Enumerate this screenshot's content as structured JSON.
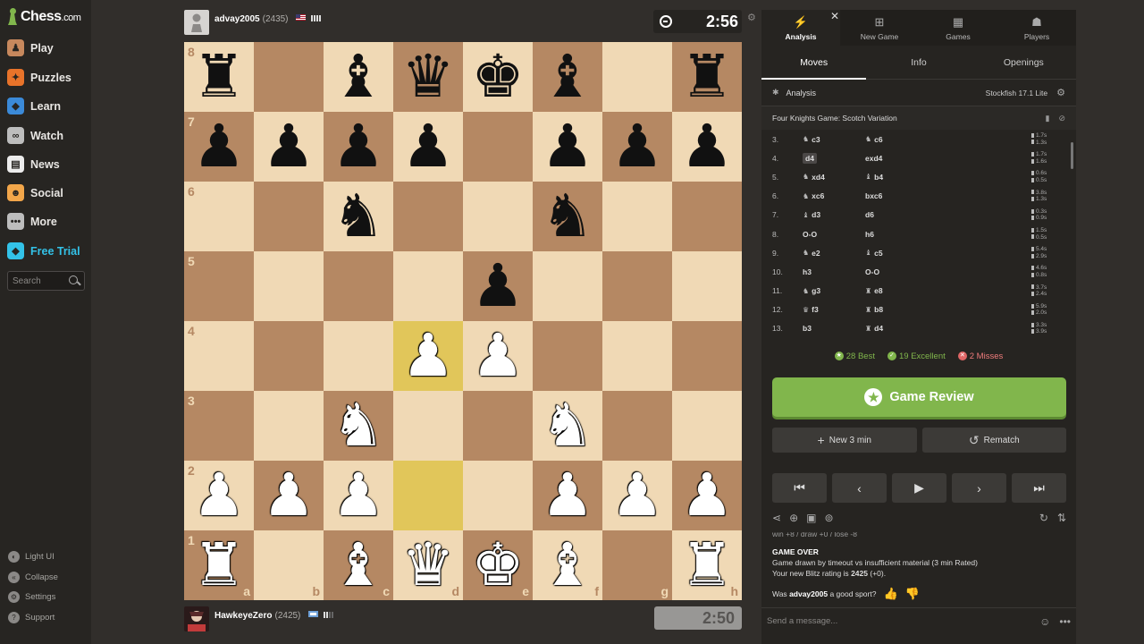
{
  "sidebar": {
    "logo": {
      "main": "Chess",
      "suffix": ".com"
    },
    "nav": [
      {
        "label": "Play",
        "icon": "play-icon",
        "color": "#c7885d",
        "glyph": "♟"
      },
      {
        "label": "Puzzles",
        "icon": "puzzles-icon",
        "color": "#e8732a",
        "glyph": "✦"
      },
      {
        "label": "Learn",
        "icon": "learn-icon",
        "color": "#3b8ad8",
        "glyph": "◆"
      },
      {
        "label": "Watch",
        "icon": "watch-icon",
        "color": "#bdbdbd",
        "glyph": "∞"
      },
      {
        "label": "News",
        "icon": "news-icon",
        "color": "#ececec",
        "glyph": "▤"
      },
      {
        "label": "Social",
        "icon": "social-icon",
        "color": "#f2a64a",
        "glyph": "☻"
      },
      {
        "label": "More",
        "icon": "more-icon",
        "color": "#bdbdbd",
        "glyph": "•••"
      },
      {
        "label": "Free Trial",
        "icon": "diamond-icon",
        "color": "#33c2e8",
        "glyph": "◆"
      }
    ],
    "search_placeholder": "Search",
    "bottom": [
      {
        "label": "Light UI",
        "icon": "light-ui-icon"
      },
      {
        "label": "Collapse",
        "icon": "collapse-icon"
      },
      {
        "label": "Settings",
        "icon": "settings-icon"
      },
      {
        "label": "Support",
        "icon": "support-icon"
      }
    ]
  },
  "top_player": {
    "name": "advay2005",
    "rating": "(2435)",
    "clock": "2:56"
  },
  "bottom_player": {
    "name": "HawkeyeZero",
    "rating": "(2425)",
    "clock": "2:50"
  },
  "board": {
    "rows": [
      [
        "r",
        "",
        "b",
        "q",
        "k",
        "b",
        "",
        "r"
      ],
      [
        "p",
        "p",
        "p",
        "p",
        "",
        "p",
        "p",
        "p"
      ],
      [
        "",
        "",
        "n",
        "",
        "",
        "n",
        "",
        ""
      ],
      [
        "",
        "",
        "",
        "",
        "p",
        "",
        "",
        ""
      ],
      [
        "",
        "",
        "",
        "P",
        "P",
        "",
        "",
        ""
      ],
      [
        "",
        "",
        "N",
        "",
        "",
        "N",
        "",
        ""
      ],
      [
        "P",
        "P",
        "P",
        "",
        "",
        "P",
        "P",
        "P"
      ],
      [
        "R",
        "",
        "B",
        "Q",
        "K",
        "B",
        "",
        "R"
      ]
    ],
    "highlighted": [
      "d4",
      "d2"
    ],
    "ranks": [
      "8",
      "7",
      "6",
      "5",
      "4",
      "3",
      "2",
      "1"
    ],
    "files": [
      "a",
      "b",
      "c",
      "d",
      "e",
      "f",
      "g",
      "h"
    ]
  },
  "panel": {
    "top_tabs": [
      {
        "label": "Analysis",
        "glyph": "⚡",
        "icon": "analysis-icon"
      },
      {
        "label": "New Game",
        "glyph": "⊞",
        "icon": "new-game-icon"
      },
      {
        "label": "Games",
        "glyph": "▦",
        "icon": "games-icon"
      },
      {
        "label": "Players",
        "glyph": "☗",
        "icon": "players-icon"
      }
    ],
    "sub_tabs": [
      "Moves",
      "Info",
      "Openings"
    ],
    "analysis_label": "Analysis",
    "engine": "Stockfish 17.1 Lite",
    "opening": "Four Knights Game: Scotch Variation",
    "moves": [
      {
        "n": "3.",
        "w": "c3",
        "wp": "♞",
        "b": "c6",
        "bp": "♞",
        "wt": "1.7s",
        "bt": "1.3s"
      },
      {
        "n": "4.",
        "w": "d4",
        "wp": "",
        "b": "exd4",
        "bp": "",
        "wt": "1.7s",
        "bt": "1.6s",
        "cur": true
      },
      {
        "n": "5.",
        "w": "xd4",
        "wp": "♞",
        "b": "b4",
        "bp": "♝",
        "wt": "0.6s",
        "bt": "0.5s"
      },
      {
        "n": "6.",
        "w": "xc6",
        "wp": "♞",
        "b": "bxc6",
        "bp": "",
        "wt": "3.8s",
        "bt": "1.3s"
      },
      {
        "n": "7.",
        "w": "d3",
        "wp": "♝",
        "b": "d6",
        "bp": "",
        "wt": "0.3s",
        "bt": "0.9s"
      },
      {
        "n": "8.",
        "w": "O-O",
        "wp": "",
        "b": "h6",
        "bp": "",
        "wt": "1.5s",
        "bt": "0.5s"
      },
      {
        "n": "9.",
        "w": "e2",
        "wp": "♞",
        "b": "c5",
        "bp": "♝",
        "wt": "5.4s",
        "bt": "2.9s"
      },
      {
        "n": "10.",
        "w": "h3",
        "wp": "",
        "b": "O-O",
        "bp": "",
        "wt": "4.6s",
        "bt": "0.8s"
      },
      {
        "n": "11.",
        "w": "g3",
        "wp": "♞",
        "b": "e8",
        "bp": "♜",
        "wt": "3.7s",
        "bt": "2.4s"
      },
      {
        "n": "12.",
        "w": "f3",
        "wp": "♛",
        "b": "b8",
        "bp": "♜",
        "wt": "5.9s",
        "bt": "2.0s"
      },
      {
        "n": "13.",
        "w": "b3",
        "wp": "",
        "b": "d4",
        "bp": "♜",
        "wt": "3.3s",
        "bt": "3.9s"
      }
    ],
    "summary": {
      "best": "28 Best",
      "excellent": "19 Excellent",
      "misses": "2 Misses"
    },
    "review_label": "Game Review",
    "new_game_label": "New 3 min",
    "rematch_label": "Rematch",
    "chat": {
      "cut_line": "win +8 / draw +0 / lose -8",
      "title": "GAME OVER",
      "line1": "Game drawn by timeout vs insufficient material (3 min Rated)",
      "line2_prefix": "Your new Blitz rating is",
      "line2_rating": "2425",
      "line2_suffix": "(+0).",
      "ask_prefix": "Was",
      "ask_name": "advay2005",
      "ask_suffix": "a good sport?"
    },
    "message_placeholder": "Send a message..."
  },
  "colors": {
    "light_square": "#f0d9b5",
    "dark_square": "#b58863",
    "highlight": "#e1c65a",
    "accent": "#81b64c"
  }
}
